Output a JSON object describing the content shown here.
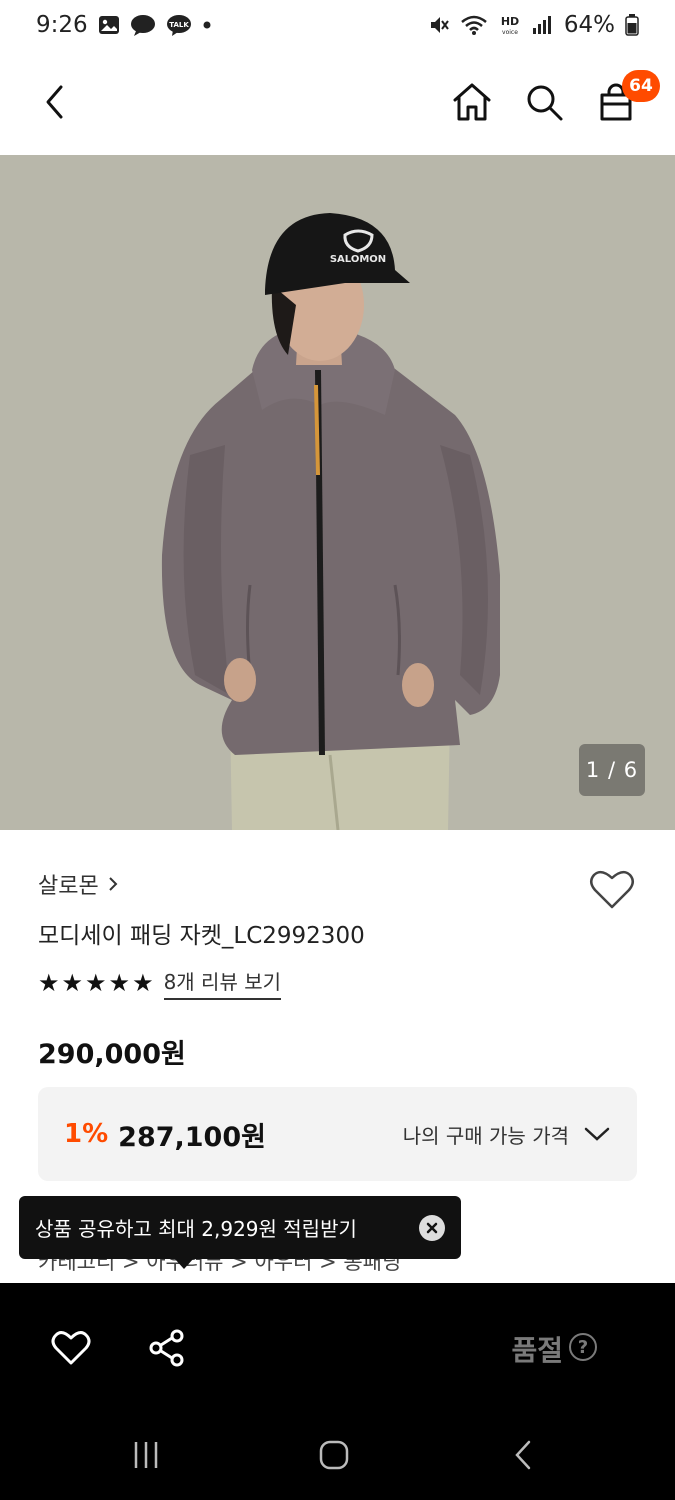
{
  "status_bar": {
    "time": "9:26",
    "battery": "64%"
  },
  "header": {
    "cart_count": "64"
  },
  "gallery": {
    "counter": "1 / 6",
    "cap_text": "SALOMON"
  },
  "product": {
    "brand": "살로몬",
    "name": "모디세이 패딩 자켓_LC2992300",
    "rating_stars": 5,
    "review_link": "8개 리뷰 보기",
    "original_price": "290,000원",
    "discount_rate": "1%",
    "discount_price": "287,100원",
    "my_price_label": "나의 구매 가능 가격",
    "category_path": "카테고리  >  아우터뷰  >  아우터  >  롱패딩"
  },
  "tooltip": {
    "text": "상품 공유하고 최대 2,929원 적립받기"
  },
  "bottom_bar": {
    "soldout_label": "품절",
    "help": "?"
  },
  "colors": {
    "accent": "#ff4b00",
    "background": "#ffffff",
    "bar": "#000000"
  }
}
